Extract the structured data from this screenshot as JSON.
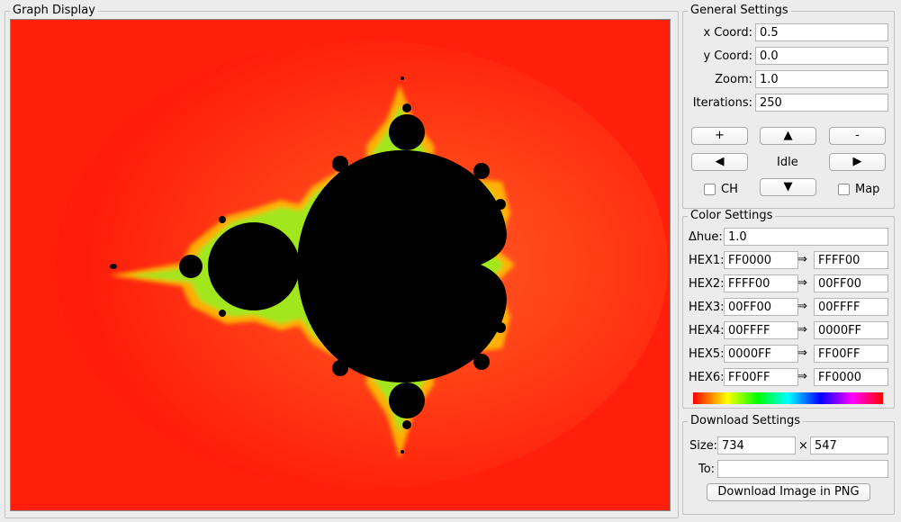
{
  "graph": {
    "title": "Graph Display"
  },
  "general": {
    "title": "General Settings",
    "x_label": "x Coord:",
    "x_value": "0.5",
    "y_label": "y Coord:",
    "y_value": "0.0",
    "zoom_label": "Zoom:",
    "zoom_value": "1.0",
    "iter_label": "Iterations:",
    "iter_value": "250",
    "zoom_in": "+",
    "zoom_out": "-",
    "up": "▲",
    "down": "▼",
    "left": "◀",
    "right": "▶",
    "status": "Idle",
    "ch_label": "CH",
    "map_label": "Map"
  },
  "color": {
    "title": "Color Settings",
    "hue_label": "Δhue:",
    "hue_value": "1.0",
    "arrow": "⇒",
    "rows": [
      {
        "label": "HEX1:",
        "from": "FF0000",
        "to": "FFFF00"
      },
      {
        "label": "HEX2:",
        "from": "FFFF00",
        "to": "00FF00"
      },
      {
        "label": "HEX3:",
        "from": "00FF00",
        "to": "00FFFF"
      },
      {
        "label": "HEX4:",
        "from": "00FFFF",
        "to": "0000FF"
      },
      {
        "label": "HEX5:",
        "from": "0000FF",
        "to": "FF00FF"
      },
      {
        "label": "HEX6:",
        "from": "FF00FF",
        "to": "FF0000"
      }
    ]
  },
  "download": {
    "title": "Download Settings",
    "size_label": "Size:",
    "width": "734",
    "times": "×",
    "height": "547",
    "to_label": "To:",
    "to_value": "",
    "button": "Download Image in PNG"
  }
}
